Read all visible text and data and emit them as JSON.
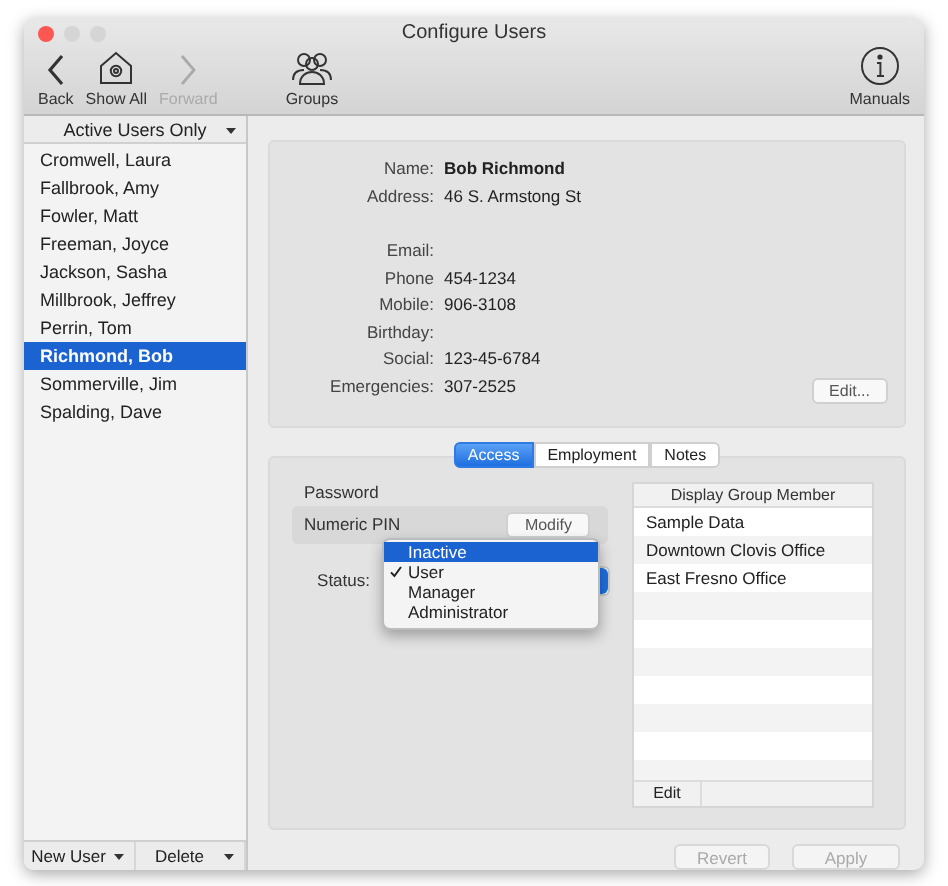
{
  "window": {
    "title": "Configure Users"
  },
  "toolbar": [
    {
      "label": "Back",
      "kind": "back",
      "disabled": false
    },
    {
      "label": "Show All",
      "kind": "home",
      "disabled": false
    },
    {
      "label": "Forward",
      "kind": "forward",
      "disabled": true
    },
    {
      "label": "Groups",
      "kind": "groups",
      "disabled": false
    },
    {
      "label": "Manuals",
      "kind": "info",
      "disabled": false
    }
  ],
  "sidebar": {
    "filter": "Active Users Only",
    "users": [
      {
        "name": "Cromwell, Laura",
        "selected": false
      },
      {
        "name": "Fallbrook, Amy",
        "selected": false
      },
      {
        "name": "Fowler, Matt",
        "selected": false
      },
      {
        "name": "Freeman, Joyce",
        "selected": false
      },
      {
        "name": "Jackson, Sasha",
        "selected": false
      },
      {
        "name": "Millbrook, Jeffrey",
        "selected": false
      },
      {
        "name": "Perrin, Tom",
        "selected": false
      },
      {
        "name": "Richmond, Bob",
        "selected": true
      },
      {
        "name": "Sommerville, Jim",
        "selected": false
      },
      {
        "name": "Spalding, Dave",
        "selected": false
      }
    ],
    "footer": [
      "New User",
      "Delete"
    ]
  },
  "details": {
    "field_groups": [
      [
        {
          "label": "Name:",
          "value": "Bob Richmond",
          "kind": "name"
        },
        {
          "label": "Address:",
          "value": "46 S. Armstong St",
          "kind": "plain"
        }
      ],
      [
        {
          "label": "Email:"
        },
        {
          "label": "Phone",
          "value": "454-1234",
          "kind": "plain"
        },
        {
          "label": "Mobile:",
          "value": "906-3108",
          "kind": "plain"
        },
        {
          "label": "Birthday:"
        },
        {
          "label": "Social:",
          "value": "123-45-6784",
          "kind": "plain"
        },
        {
          "label": "Emergencies:",
          "value": "307-2525",
          "kind": "plain"
        }
      ]
    ],
    "edit_button": "Edit..."
  },
  "tabs": [
    {
      "label": "Access",
      "selected": true
    },
    {
      "label": "Employment",
      "selected": false
    },
    {
      "label": "Notes",
      "selected": false
    }
  ],
  "access": {
    "password_heading": "Password",
    "pin_label": "Numeric PIN",
    "modify_button": "Modify",
    "status_label": "Status:",
    "status_menu": [
      {
        "label": "Inactive",
        "selected": true,
        "checked": false
      },
      {
        "label": "User",
        "selected": false,
        "checked": true
      },
      {
        "label": "Manager",
        "selected": false,
        "checked": false
      },
      {
        "label": "Administrator",
        "selected": false,
        "checked": false
      }
    ]
  },
  "groups_table": {
    "column": "Display Group Member",
    "rows": [
      "Sample Data",
      "Downtown Clovis Office",
      "East Fresno Office"
    ],
    "edit_button": "Edit"
  },
  "buttons": [
    {
      "label": "Revert",
      "disabled": true
    },
    {
      "label": "Apply",
      "disabled": true
    }
  ]
}
